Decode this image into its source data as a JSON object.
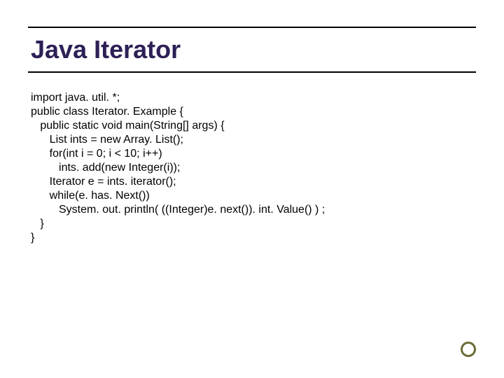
{
  "title": "Java Iterator",
  "code": {
    "l1": "import java. util. *;",
    "l2": "public class Iterator. Example {",
    "l3": "   public static void main(String[] args) {",
    "l4": "      List ints = new Array. List();",
    "l5": "      for(int i = 0; i < 10; i++)",
    "l6": "         ints. add(new Integer(i));",
    "l7": "      Iterator e = ints. iterator();",
    "l8": "      while(e. has. Next())",
    "l9": "         System. out. println( ((Integer)e. next()). int. Value() ) ;",
    "l10": "   }",
    "l11": "}"
  }
}
